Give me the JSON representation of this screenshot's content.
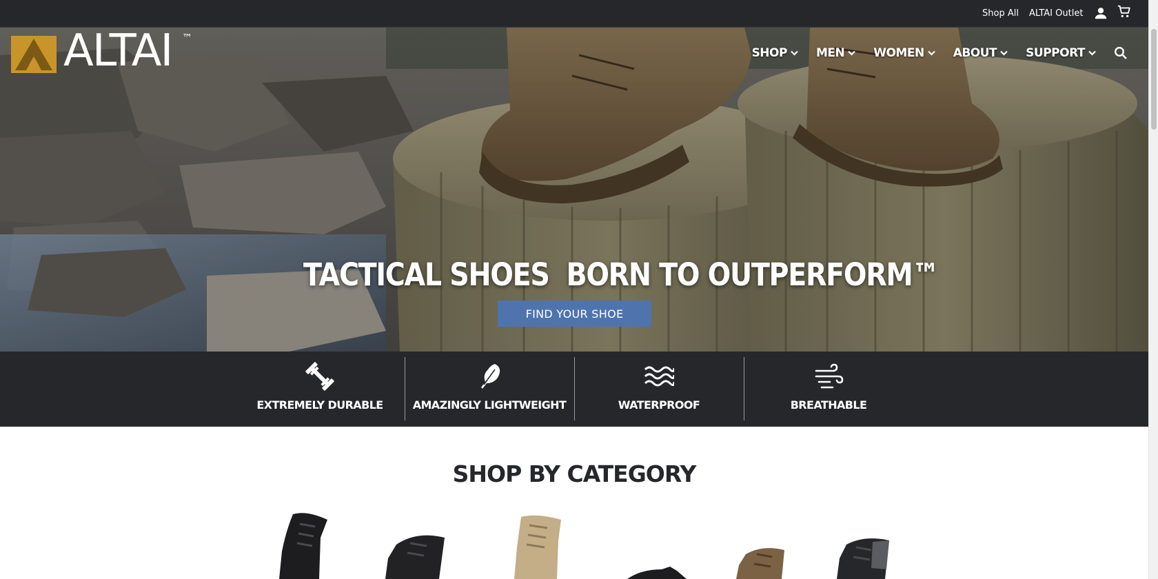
{
  "utility_bar": {
    "shop_all": "Shop All",
    "outlet": "ALTAI Outlet",
    "account_icon": "account-icon",
    "cart_icon": "cart-icon"
  },
  "brand": {
    "logo_text": "ALTAI",
    "trademark": "™",
    "accent_color": "#c9952b"
  },
  "nav": {
    "items": [
      {
        "label": "SHOP"
      },
      {
        "label": "MEN"
      },
      {
        "label": "WOMEN"
      },
      {
        "label": "ABOUT"
      },
      {
        "label": "SUPPORT"
      }
    ],
    "search_icon": "search-icon"
  },
  "hero": {
    "headline": "TACTICAL SHOES  BORN TO OUTPERFORM™",
    "cta_label": "FIND YOUR SHOE",
    "cta_color": "#4f74ad"
  },
  "features": [
    {
      "label": "EXTREMELY DURABLE",
      "icon": "dumbbell-icon"
    },
    {
      "label": "AMAZINGLY LIGHTWEIGHT",
      "icon": "feather-icon"
    },
    {
      "label": "WATERPROOF",
      "icon": "waves-icon"
    },
    {
      "label": "BREATHABLE",
      "icon": "wind-icon"
    }
  ],
  "category_section": {
    "title": "SHOP BY CATEGORY"
  },
  "theme": {
    "dark_band": "#26272b",
    "white": "#ffffff"
  }
}
